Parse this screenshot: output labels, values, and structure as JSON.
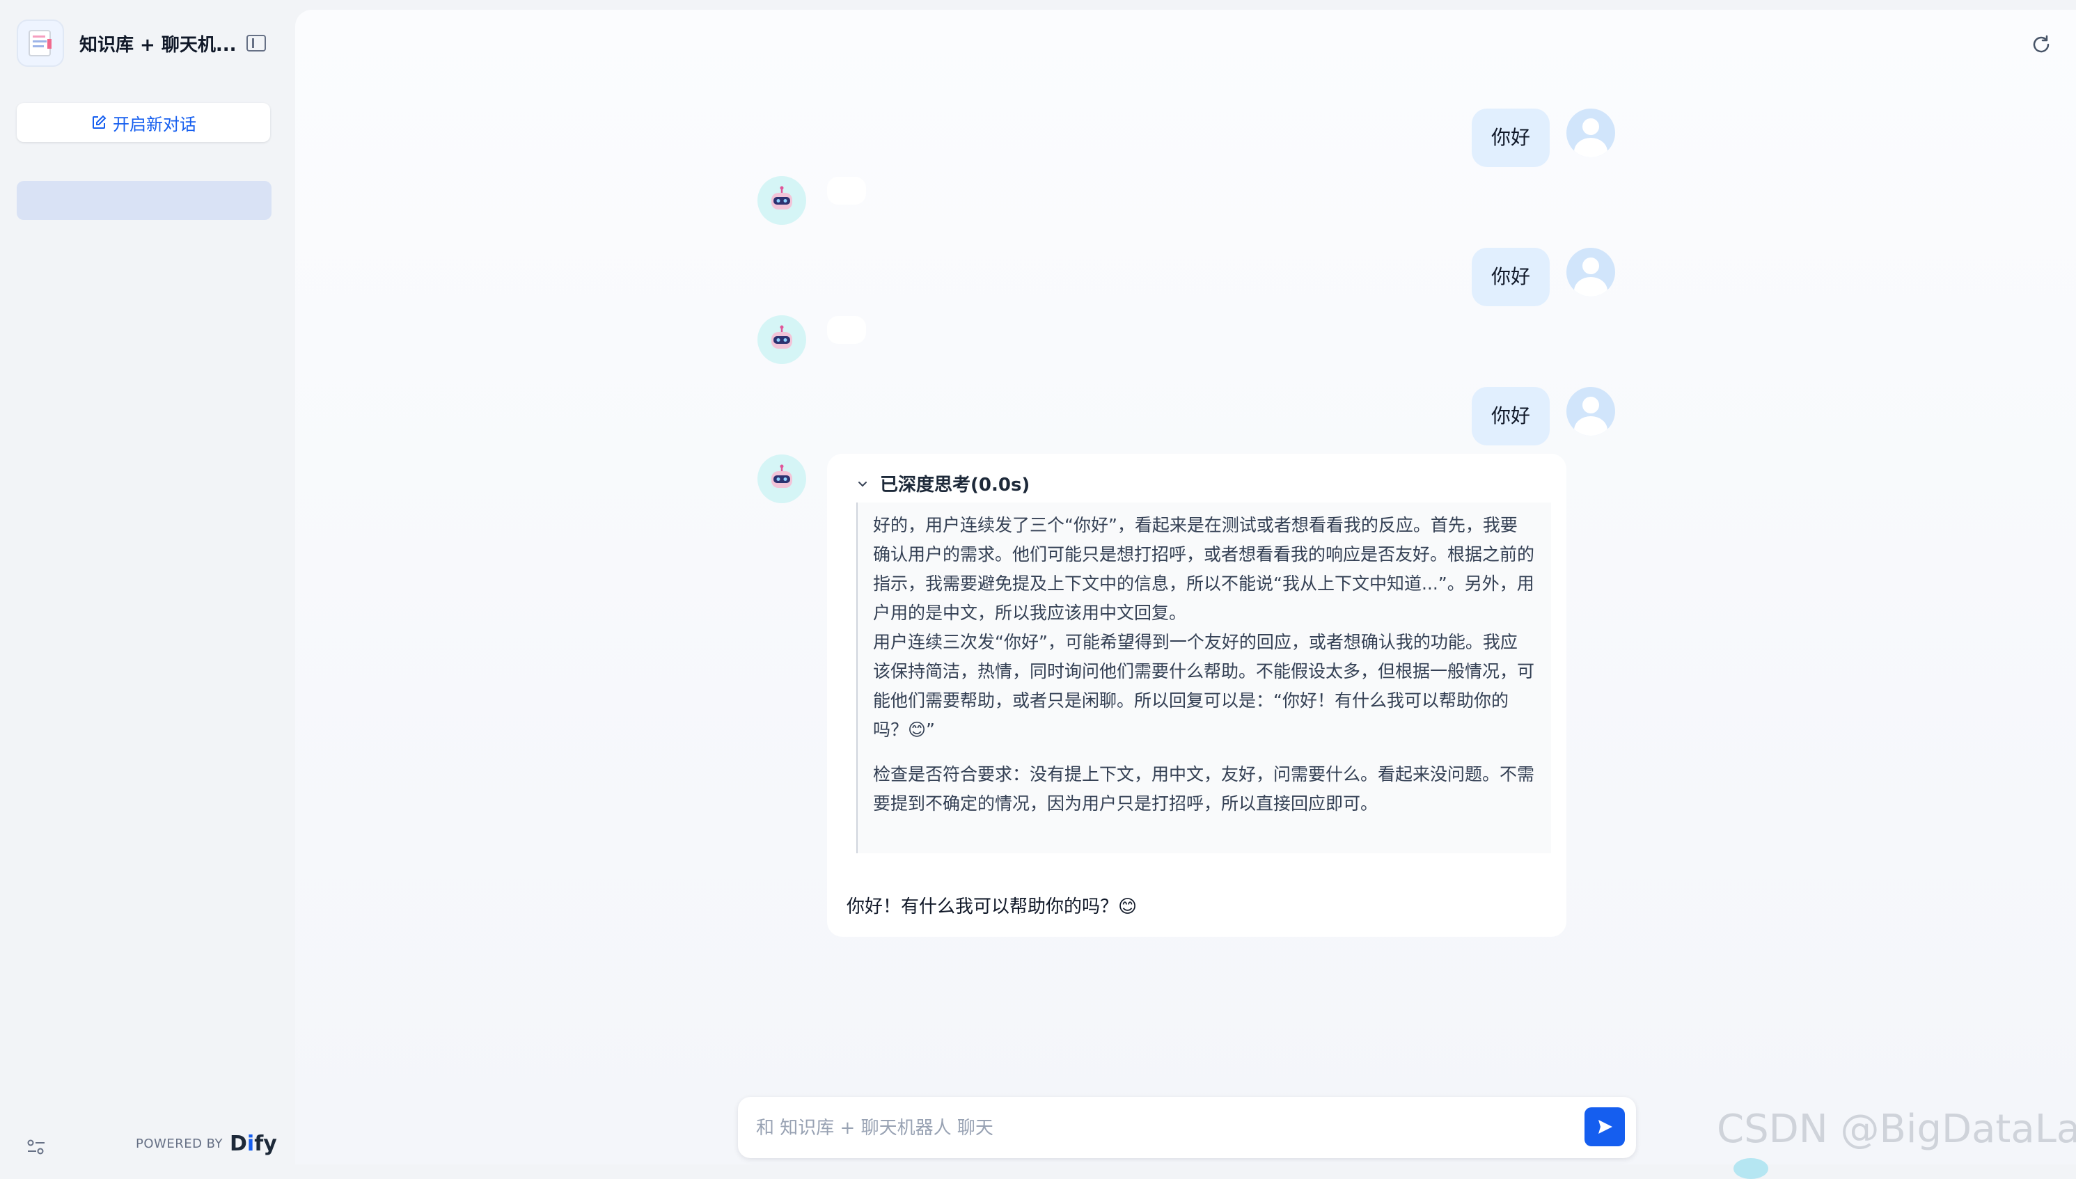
{
  "sidebar": {
    "app_title": "知识库 + 聊天机...",
    "new_chat_label": "开启新对话",
    "powered_by": "POWERED BY",
    "brand": {
      "pre": "D",
      "i": "i",
      "post": "fy"
    }
  },
  "messages": [
    {
      "role": "user",
      "text": "你好"
    },
    {
      "role": "assistant",
      "text": ""
    },
    {
      "role": "user",
      "text": "你好"
    },
    {
      "role": "assistant",
      "text": ""
    },
    {
      "role": "user",
      "text": "你好"
    },
    {
      "role": "assistant",
      "thinking_title": "已深度思考(0.0s)",
      "thinking_p1": "好的，用户连续发了三个“你好”，看起来是在测试或者想看看我的反应。首先，我要确认用户的需求。他们可能只是想打招呼，或者想看看我的响应是否友好。根据之前的指示，我需要避免提及上下文中的信息，所以不能说“我从上下文中知道...”。另外，用户用的是中文，所以我应该用中文回复。",
      "thinking_p2": "用户连续三次发“你好”，可能希望得到一个友好的回应，或者想确认我的功能。我应该保持简洁，热情，同时询问他们需要什么帮助。不能假设太多，但根据一般情况，可能他们需要帮助，或者只是闲聊。所以回复可以是：“你好！有什么我可以帮助你的吗？😊”",
      "thinking_p3": "检查是否符合要求：没有提上下文，用中文，友好，问需要什么。看起来没问题。不需要提到不确定的情况，因为用户只是打招呼，所以直接回应即可。",
      "answer": "你好！有什么我可以帮助你的吗？😊"
    }
  ],
  "input": {
    "placeholder": "和 知识库 + 聊天机器人 聊天",
    "value": ""
  },
  "watermark": "CSDN @BigDataLab",
  "colors": {
    "accent": "#155eef",
    "user_bubble": "#e1effe",
    "bot_avatar_bg": "#d5f5f6"
  }
}
